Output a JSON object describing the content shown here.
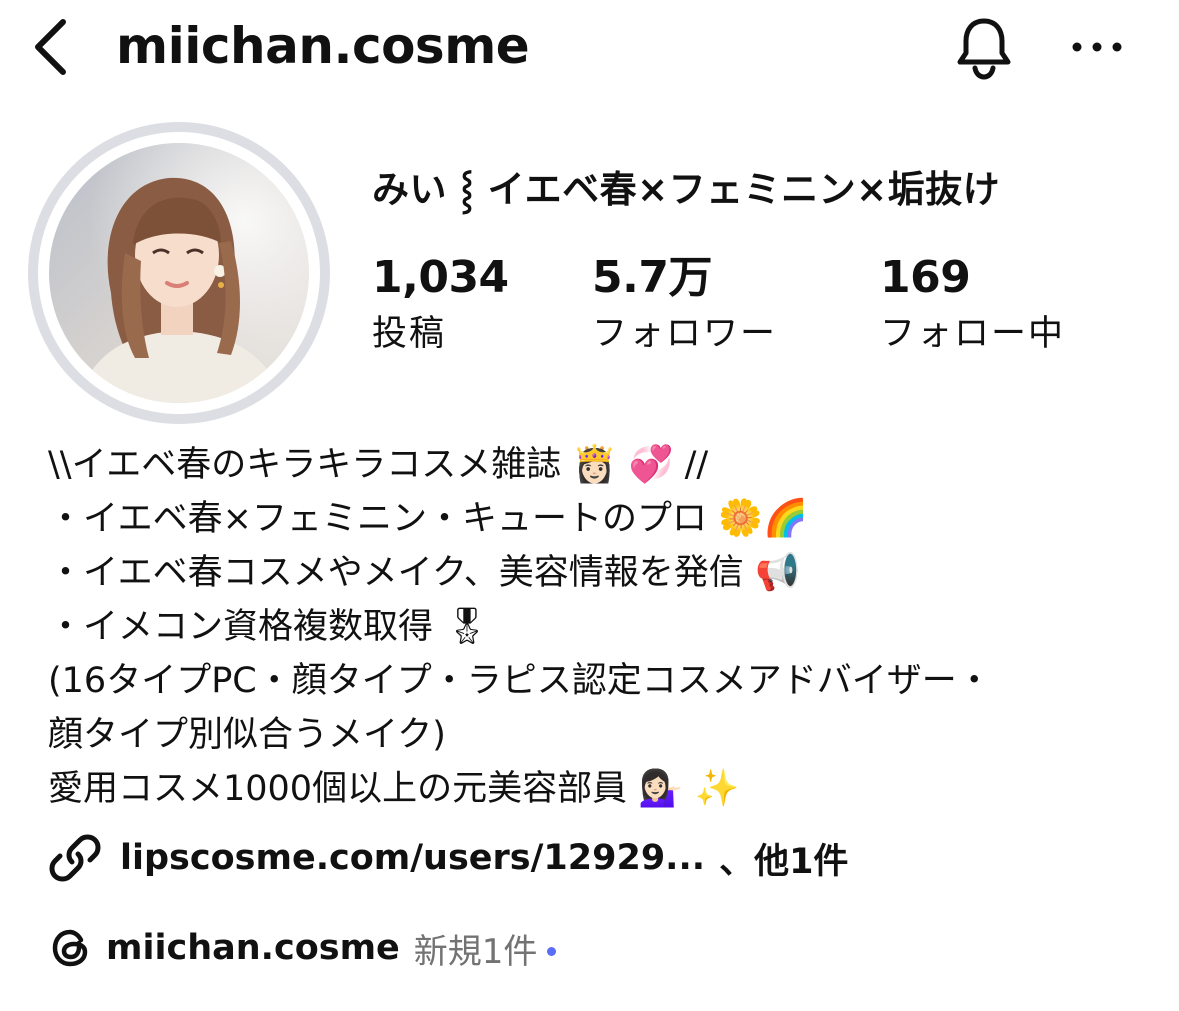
{
  "header": {
    "username": "miichan.cosme",
    "back_icon": "chevron-left-icon",
    "bell_icon": "bell-icon",
    "more_icon": "more-horizontal-icon"
  },
  "profile": {
    "display_name": "みい ⸾ イエベ春×フェミニン×垢抜け",
    "avatar": "profile-photo",
    "stats": [
      {
        "value": "1,034",
        "label": "投稿"
      },
      {
        "value": "5.7万",
        "label": "フォロワー"
      },
      {
        "value": "169",
        "label": "フォロー中"
      }
    ]
  },
  "bio": {
    "lines": [
      {
        "text": "\\\\イエベ春のキラキラコスメ雑誌",
        "emoji": "👸🏻 💞",
        "suffix": "//"
      },
      {
        "text": "・イエベ春×フェミニン・キュートのプロ",
        "emoji": "🌼🌈",
        "suffix": ""
      },
      {
        "text": "・イエベ春コスメやメイク、美容情報を発信",
        "emoji": "📢",
        "suffix": ""
      },
      {
        "text": "・イメコン資格複数取得",
        "emoji": "🎖",
        "suffix": ""
      },
      {
        "text": "(16タイプPC・顔タイプ・ラピス認定コスメアドバイザー・",
        "emoji": "",
        "suffix": ""
      },
      {
        "text": "顔タイプ別似合うメイク)",
        "emoji": "",
        "suffix": ""
      },
      {
        "text": "愛用コスメ1000個以上の元美容部員",
        "emoji": "💁🏻‍♀️ ✨",
        "suffix": ""
      }
    ]
  },
  "link": {
    "icon": "link-icon",
    "text": "lipscosme.com/users/12929...",
    "more": "、他1件"
  },
  "threads": {
    "icon": "threads-icon",
    "handle": "miichan.cosme",
    "new_label": "新規1件",
    "dot_color": "#5b6cf5"
  },
  "colors": {
    "text": "#111111",
    "secondary_text": "#737373",
    "avatar_ring": "#dcdee3",
    "background": "#ffffff"
  }
}
